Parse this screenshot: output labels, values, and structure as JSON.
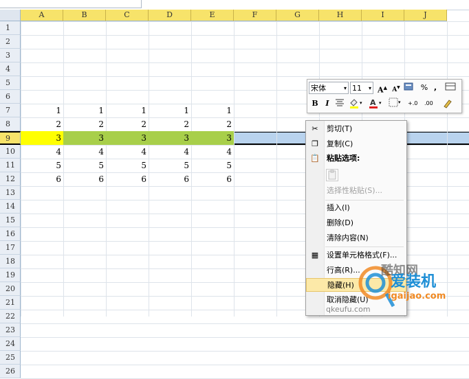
{
  "columns": [
    "A",
    "B",
    "C",
    "D",
    "E",
    "F",
    "G",
    "H",
    "I",
    "J"
  ],
  "rows": [
    "1",
    "2",
    "3",
    "4",
    "5",
    "6",
    "7",
    "8",
    "9",
    "10",
    "11",
    "12",
    "13",
    "14",
    "15",
    "16",
    "17",
    "18",
    "19",
    "20",
    "21",
    "22",
    "23",
    "24",
    "25",
    "26"
  ],
  "selected_row": "9",
  "data_rows": [
    {
      "row": "7",
      "values": [
        "1",
        "1",
        "1",
        "1",
        "1"
      ]
    },
    {
      "row": "8",
      "values": [
        "2",
        "2",
        "2",
        "2",
        "2"
      ]
    },
    {
      "row": "9",
      "values": [
        "3",
        "3",
        "3",
        "3",
        "3"
      ]
    },
    {
      "row": "10",
      "values": [
        "4",
        "4",
        "4",
        "4",
        "4"
      ]
    },
    {
      "row": "11",
      "values": [
        "5",
        "5",
        "5",
        "5",
        "5"
      ]
    },
    {
      "row": "12",
      "values": [
        "6",
        "6",
        "6",
        "6",
        "6"
      ]
    }
  ],
  "mini_toolbar": {
    "font_name": "宋体",
    "font_size": "11",
    "bold": "B",
    "italic": "I",
    "percent": "%",
    "comma": ",",
    "dec_inc": "+.0",
    "dec_dec": ".00",
    "grow": "A",
    "shrink": "A"
  },
  "context_menu": {
    "cut": "剪切(T)",
    "copy": "复制(C)",
    "paste_options": "粘贴选项:",
    "paste_special": "选择性粘贴(S)...",
    "insert": "插入(I)",
    "delete": "删除(D)",
    "clear": "清除内容(N)",
    "format_cells": "设置单元格格式(F)...",
    "row_height": "行高(R)...",
    "hide": "隐藏(H)",
    "unhide": "取消隐藏(U)"
  },
  "watermark": {
    "brand": "爱装机",
    "site": "igaijao.com",
    "text2": "酷知网",
    "site2": "qkeufu.com"
  },
  "colors": {
    "col_header": "#f7e36a",
    "row_band": "#b9d3ee",
    "cell_highlight": "#a8cf4a",
    "active_cell": "#ffff00",
    "menu_hover": "#fce9a8"
  }
}
